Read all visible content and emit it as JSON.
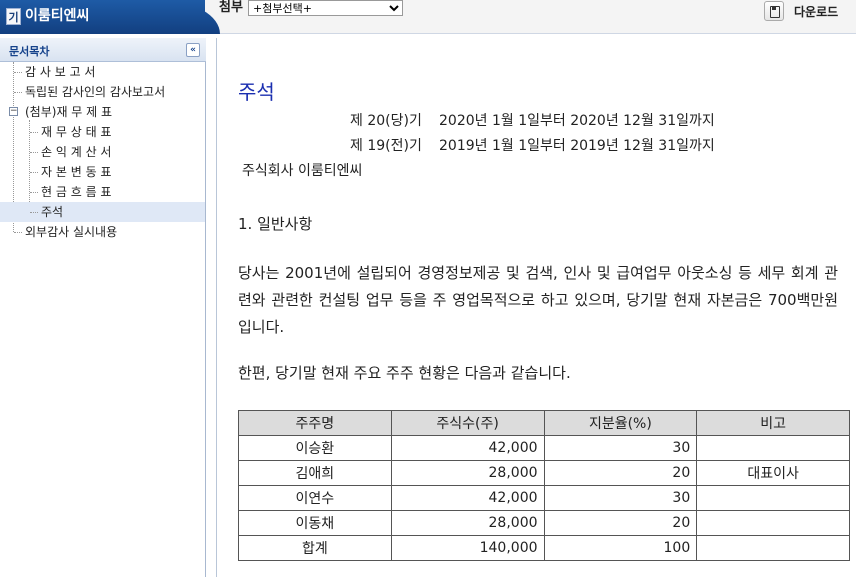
{
  "app": {
    "logo_text": "기",
    "company_name": "이룸티엔씨"
  },
  "toolbar": {
    "attach_label": "첨부",
    "attach_selected": "+첨부선택+",
    "download_label": "다운로드"
  },
  "sidebar": {
    "title": "문서목차",
    "collapse_symbol": "«",
    "items": [
      {
        "label": "감 사 보 고 서"
      },
      {
        "label": "독립된 감사인의 감사보고서"
      },
      {
        "label": "(첨부)재 무 제 표",
        "toggle": "−"
      },
      {
        "label": "재 무 상 태 표"
      },
      {
        "label": "손 익 계 산 서"
      },
      {
        "label": "자 본 변 동 표"
      },
      {
        "label": "현 금 흐 름 표"
      },
      {
        "label": "주석"
      },
      {
        "label": "외부감사 실시내용"
      }
    ]
  },
  "document": {
    "title": "주석",
    "period_current": {
      "label": "제 20(당)기",
      "range": "2020년 1월 1일부터  2020년 12월 31일까지"
    },
    "period_prior": {
      "label": "제 19(전)기",
      "range": "2019년 1월 1일부터  2019년 12월 31일까지"
    },
    "company": "주식회사 이룸티엔씨",
    "section_heading": "1. 일반사항",
    "paragraph1": "당사는 2001년에 설립되어 경영정보제공 및 검색, 인사 및 급여업무 아웃소싱 등 세무 회계 관련와 관련한 컨설팅 업무 등을 주 영업목적으로 하고 있으며, 당기말 현재 자본금은 700백만원입니다.",
    "paragraph2": "한편, 당기말 현재 주요 주주 현황은 다음과 같습니다.",
    "table": {
      "headers": [
        "주주명",
        "주식수(주)",
        "지분율(%)",
        "비고"
      ],
      "rows": [
        {
          "name": "이승환",
          "shares": "42,000",
          "ratio": "30",
          "note": ""
        },
        {
          "name": "김애희",
          "shares": "28,000",
          "ratio": "20",
          "note": "대표이사"
        },
        {
          "name": "이연수",
          "shares": "42,000",
          "ratio": "30",
          "note": ""
        },
        {
          "name": "이동채",
          "shares": "28,000",
          "ratio": "20",
          "note": ""
        },
        {
          "name": "합계",
          "shares": "140,000",
          "ratio": "100",
          "note": ""
        }
      ]
    }
  }
}
